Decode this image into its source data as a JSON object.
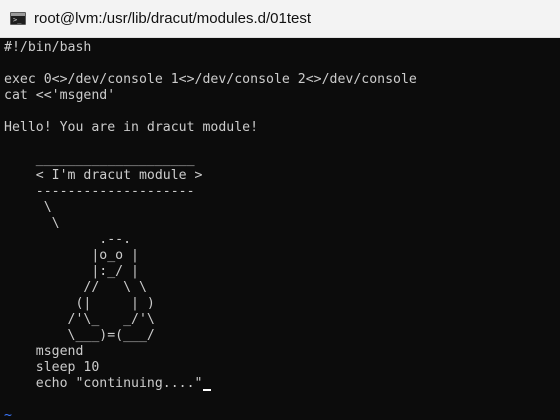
{
  "window": {
    "title": "root@lvm:/usr/lib/dracut/modules.d/01test",
    "icon": "terminal-icon"
  },
  "terminal": {
    "lines": [
      "#!/bin/bash",
      "",
      "exec 0<>/dev/console 1<>/dev/console 2<>/dev/console",
      "cat <<'msgend'",
      "",
      "Hello! You are in dracut module!",
      "",
      "    ____________________",
      "    < I'm dracut module >",
      "    --------------------",
      "     \\",
      "      \\",
      "            .--.",
      "           |o_o |",
      "           |:_/ |",
      "          //   \\ \\",
      "         (|     | )",
      "        /'\\_   _/'\\",
      "        \\___)=(___/",
      "    msgend",
      "    sleep 10",
      "    echo \"continuing....\"",
      "",
      "~",
      "~"
    ],
    "tilde_color": "#3b78ff",
    "text_color": "#cccccc",
    "background": "#0c0c0c"
  }
}
